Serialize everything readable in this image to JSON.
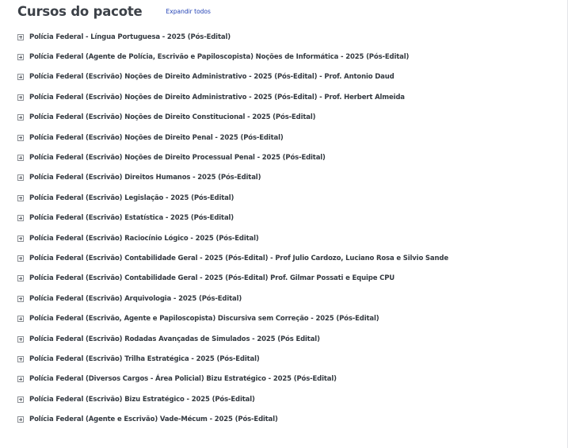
{
  "header": {
    "title": "Cursos do pacote",
    "expand_all_label": "Expandir todos"
  },
  "courses": [
    "Polícia Federal - Língua Portuguesa - 2025 (Pós-Edital)",
    "Polícia Federal (Agente de Polícia, Escrivão e Papiloscopista) Noções de Informática - 2025 (Pós-Edital)",
    "Polícia Federal (Escrivão) Noções de Direito Administrativo - 2025 (Pós-Edital) - Prof. Antonio Daud",
    "Polícia Federal (Escrivão) Noções de Direito Administrativo - 2025 (Pós-Edital) - Prof. Herbert Almeida",
    "Polícia Federal (Escrivão) Noções de Direito Constitucional - 2025 (Pós-Edital)",
    "Polícia Federal (Escrivão) Noções de Direito Penal - 2025 (Pós-Edital)",
    "Polícia Federal (Escrivão) Noções de Direito Processual Penal - 2025 (Pós-Edital)",
    "Polícia Federal (Escrivão) Direitos Humanos - 2025 (Pós-Edital)",
    "Polícia Federal (Escrivão) Legislação - 2025 (Pós-Edital)",
    "Polícia Federal (Escrivão) Estatística - 2025 (Pós-Edital)",
    "Polícia Federal (Escrivão) Raciocínio Lógico - 2025 (Pós-Edital)",
    "Polícia Federal (Escrivão) Contabilidade Geral - 2025 (Pós-Edital) - Prof Julio Cardozo, Luciano Rosa e Silvio Sande",
    "Polícia Federal (Escrivão) Contabilidade Geral - 2025 (Pós-Edital) Prof. Gilmar Possati e Equipe CPU",
    "Polícia Federal (Escrivão) Arquivologia - 2025 (Pós-Edital)",
    "Polícia Federal (Escrivão, Agente e Papiloscopista) Discursiva sem Correção - 2025 (Pós-Edital)",
    "Polícia Federal (Escrivão) Rodadas Avançadas de Simulados - 2025 (Pós Edital)",
    "Polícia Federal (Escrivão) Trilha Estratégica - 2025 (Pós-Edital)",
    "Polícia Federal (Diversos Cargos - Área Policial) Bizu Estratégico - 2025 (Pós-Edital)",
    "Polícia Federal (Escrivão) Bizu Estratégico - 2025 (Pós-Edital)",
    "Polícia Federal (Agente e Escrivão) Vade-Mécum - 2025 (Pós-Edital)"
  ],
  "icons": {
    "expand": "plus-box-icon"
  },
  "colors": {
    "title": "#3c4148",
    "link": "#1f3fb4",
    "item_text": "#343a41"
  }
}
